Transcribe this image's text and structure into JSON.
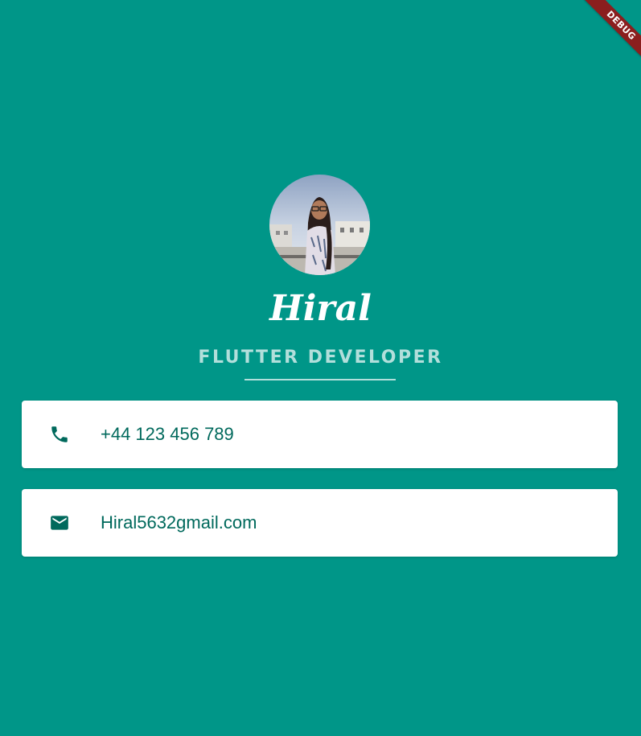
{
  "debug_banner": {
    "label": "DEBUG"
  },
  "profile": {
    "name": "Hiral",
    "title": "FLUTTER DEVELOPER"
  },
  "contacts": {
    "phone": {
      "icon": "phone-icon",
      "value": "+44 123 456 789"
    },
    "email": {
      "icon": "mail-icon",
      "value": "Hiral5632gmail.com"
    }
  },
  "colors": {
    "background": "#009688",
    "title_text": "#b2dfdb",
    "card_text": "#00695c",
    "icon": "#00695c",
    "debug_ribbon": "#8b1e1e"
  }
}
